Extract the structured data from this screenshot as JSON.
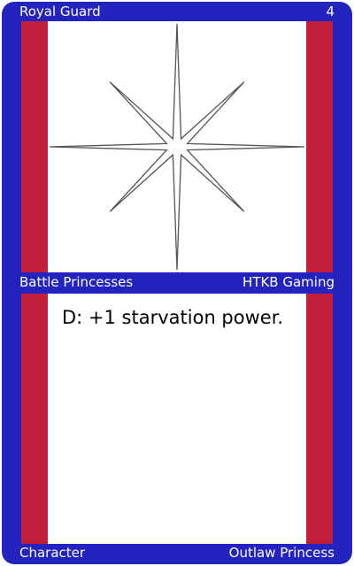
{
  "card": {
    "name": "Royal Guard",
    "cost": "4",
    "set_name": "Battle Princesses",
    "publisher": "HTKB Gaming",
    "rules_text": "D: +1 starvation power.",
    "type": "Character",
    "subtype": "Outlaw Princess",
    "art_icon": "eight-point-star-icon"
  },
  "colors": {
    "frame": "#2323c0",
    "stripe": "#c21f3c",
    "panel": "#ffffff",
    "text_light": "#ffffff",
    "text_dark": "#000000"
  }
}
